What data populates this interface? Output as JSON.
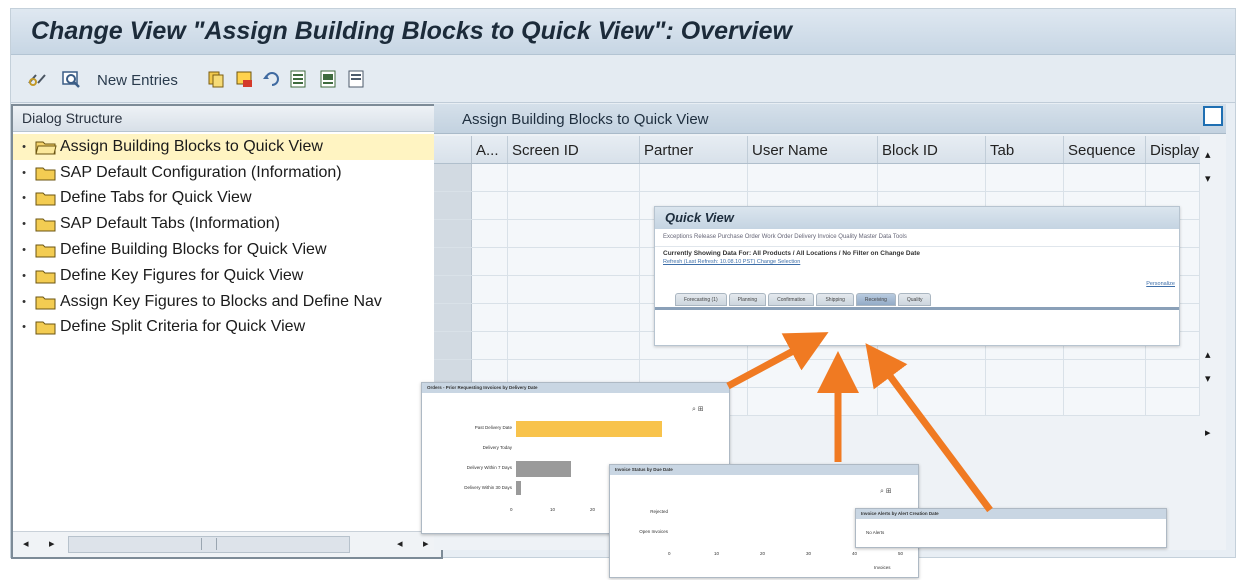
{
  "window": {
    "title": "Change View \"Assign Building Blocks to Quick View\": Overview"
  },
  "toolbar": {
    "items": [
      {
        "icon": "glasses-icon"
      },
      {
        "icon": "display-change-icon"
      },
      {
        "label": "New Entries"
      },
      {
        "icon": "copy-icon"
      },
      {
        "icon": "delete-icon"
      },
      {
        "icon": "undo-icon"
      },
      {
        "icon": "select-all-icon"
      },
      {
        "icon": "select-block-icon"
      },
      {
        "icon": "deselect-all-icon"
      }
    ]
  },
  "dialog_structure": {
    "title": "Dialog Structure",
    "items": [
      {
        "label": "Assign Building Blocks to Quick View",
        "selected": true,
        "open": true
      },
      {
        "label": "SAP Default Configuration (Information)"
      },
      {
        "label": "Define Tabs for Quick View"
      },
      {
        "label": "SAP Default Tabs (Information)"
      },
      {
        "label": "Define Building Blocks for Quick View"
      },
      {
        "label": "Define Key Figures for Quick View"
      },
      {
        "label": "Assign Key Figures to Blocks and Define Nav"
      },
      {
        "label": "Define Split Criteria for Quick View"
      }
    ]
  },
  "table": {
    "title": "Assign Building Blocks to Quick View",
    "columns": [
      "A...",
      "Screen ID",
      "Partner",
      "User Name",
      "Block ID",
      "Tab",
      "Sequence",
      "Display"
    ],
    "row_count": 9
  },
  "quick_view": {
    "title": "Quick View",
    "toolbar_text": "Exceptions   Release   Purchase Order   Work Order   Delivery   Invoice   Quality   Master Data   Tools",
    "data_line": "Currently Showing Data For: All Products / All Locations / No Filter on Change Date",
    "refresh_link": "Refresh (Last Refresh: 10.08.10 PST)  Change Selection",
    "right_link": "Personalize",
    "tabs": [
      "Forecasting (1)",
      "Planning",
      "Confirmation",
      "Shipping",
      "Receiving",
      "Quality"
    ],
    "active_tab": 4
  },
  "mini_panels": {
    "delivery": {
      "title": "Orders - Prior Requesting Invoices by Delivery Date",
      "rows": [
        "Past Delivery Date",
        "Delivery Today",
        "Delivery Within 7 Days",
        "Delivery Within 30 Days"
      ],
      "axis": [
        "0",
        "10",
        "20"
      ]
    },
    "invoice": {
      "title": "Invoice Status by Due Date",
      "rows": [
        "Rejected",
        "Open Invoices"
      ],
      "axis": [
        "0",
        "10",
        "20",
        "30",
        "40",
        "50"
      ],
      "unit": "Invoices"
    },
    "alerts": {
      "title": "Invoice Alerts by Alert Creation Date",
      "text": "No Alerts"
    }
  },
  "colors": {
    "accent_orange": "#f07a22",
    "selected_row": "#fff4c2",
    "bar_yellow": "#f8c34c",
    "bar_gray": "#9a9a9a"
  }
}
